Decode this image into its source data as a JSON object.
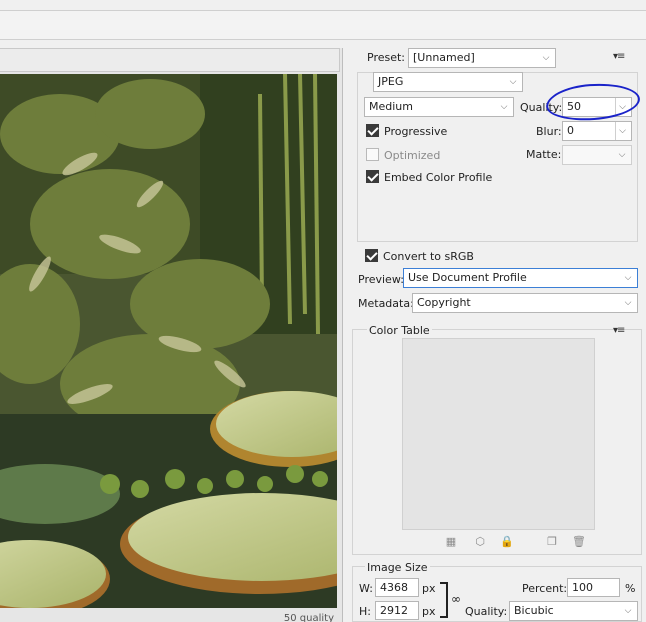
{
  "left": {
    "status_text": "50 quality"
  },
  "preset": {
    "label": "Preset:",
    "value": "[Unnamed]"
  },
  "format": {
    "value": "JPEG"
  },
  "compression": {
    "value": "Medium"
  },
  "quality": {
    "label": "Quality:",
    "value": "50"
  },
  "blur": {
    "label": "Blur:",
    "value": "0"
  },
  "matte": {
    "label": "Matte:",
    "value": ""
  },
  "options": {
    "progressive": {
      "label": "Progressive",
      "checked": true
    },
    "optimized": {
      "label": "Optimized",
      "checked": false,
      "disabled": true
    },
    "embed_color_profile": {
      "label": "Embed Color Profile",
      "checked": true
    }
  },
  "convert_srgb": {
    "label": "Convert to sRGB",
    "checked": true
  },
  "preview": {
    "label": "Preview:",
    "value": "Use Document Profile"
  },
  "metadata": {
    "label": "Metadata:",
    "value": "Copyright"
  },
  "color_table": {
    "title": "Color Table"
  },
  "image_size": {
    "title": "Image Size",
    "w_label": "W:",
    "w_value": "4368",
    "w_unit": "px",
    "h_label": "H:",
    "h_value": "2912",
    "h_unit": "px",
    "percent_label": "Percent:",
    "percent_value": "100",
    "percent_unit": "%",
    "quality_label": "Quality:",
    "quality_value": "Bicubic"
  },
  "colors": {
    "annotation": "#1a23c9",
    "focus_border": "#3c7fd6"
  }
}
